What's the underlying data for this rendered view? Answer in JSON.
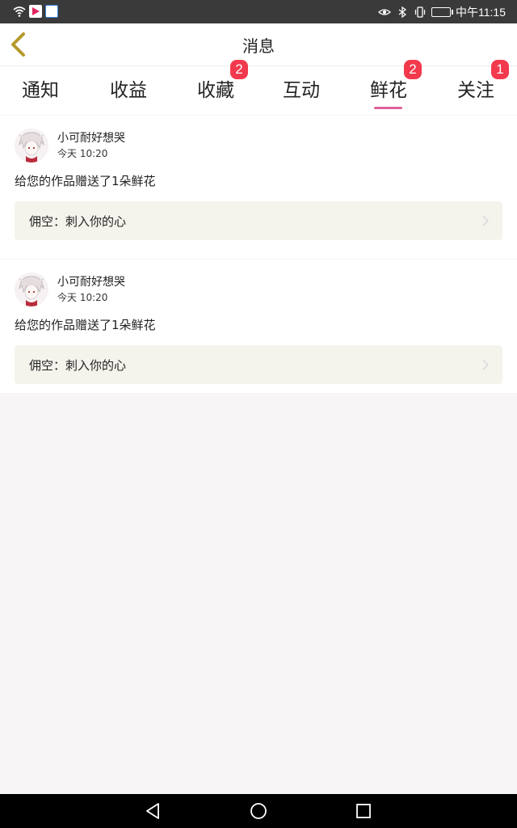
{
  "status_bar": {
    "time": "中午11:15",
    "icons": [
      "wifi-icon",
      "video-app-icon",
      "app-icon",
      "eye-icon",
      "bluetooth-icon",
      "vibrate-icon",
      "battery-icon"
    ]
  },
  "header": {
    "title": "消息",
    "back_icon": "chevron-left-icon"
  },
  "tabs": [
    {
      "label": "通知",
      "badge": ""
    },
    {
      "label": "收益",
      "badge": ""
    },
    {
      "label": "收藏",
      "badge": "2"
    },
    {
      "label": "互动",
      "badge": ""
    },
    {
      "label": "鲜花",
      "badge": "2",
      "active": true
    },
    {
      "label": "关注",
      "badge": "1"
    }
  ],
  "messages": [
    {
      "sender": "小可耐好想哭",
      "time": "今天 10:20",
      "text": "给您的作品赠送了1朵鲜花",
      "work": "佣空：刺入你的心"
    },
    {
      "sender": "小可耐好想哭",
      "time": "今天 10:20",
      "text": "给您的作品赠送了1朵鲜花",
      "work": "佣空：刺入你的心"
    }
  ],
  "colors": {
    "accent": "#e0609a",
    "badge": "#f2394d",
    "back_arrow": "#b59a2c",
    "work_bg": "#f4f3ec"
  },
  "nav_bar": {
    "icons": [
      "back-triangle-icon",
      "home-circle-icon",
      "recents-square-icon"
    ]
  }
}
